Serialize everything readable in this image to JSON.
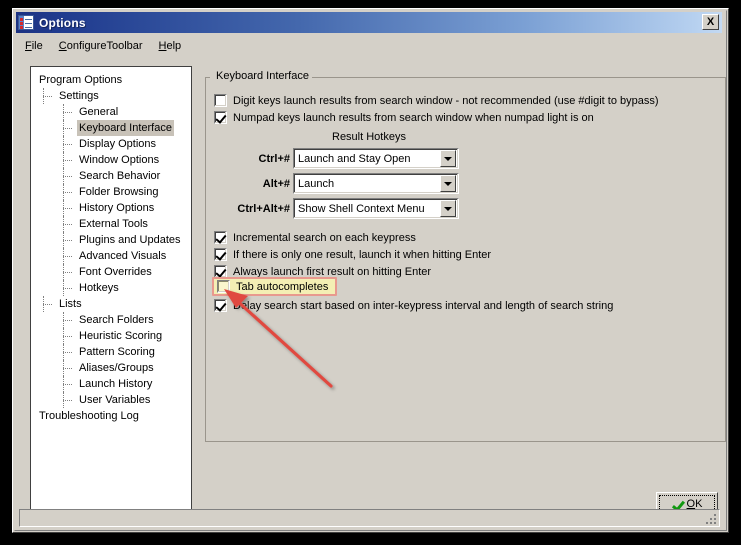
{
  "window": {
    "title": "Options",
    "icon": "options-checklist-icon",
    "close_label": "X",
    "titlebar_gradient_start": "#1c3282",
    "titlebar_gradient_end": "#c3d9f2",
    "face_color": "#d4d0c8"
  },
  "menubar": {
    "items": [
      {
        "label": "File",
        "accel": "F"
      },
      {
        "label": "ConfigureToolbar",
        "accel": "C"
      },
      {
        "label": "Help",
        "accel": "H"
      }
    ]
  },
  "tree": {
    "nodes": [
      {
        "label": "Program Options",
        "level": 0,
        "selected": false
      },
      {
        "label": "Settings",
        "level": 1,
        "selected": false
      },
      {
        "label": "General",
        "level": 2,
        "selected": false
      },
      {
        "label": "Keyboard Interface",
        "level": 2,
        "selected": true
      },
      {
        "label": "Display Options",
        "level": 2,
        "selected": false
      },
      {
        "label": "Window Options",
        "level": 2,
        "selected": false
      },
      {
        "label": "Search Behavior",
        "level": 2,
        "selected": false
      },
      {
        "label": "Folder Browsing",
        "level": 2,
        "selected": false
      },
      {
        "label": "History Options",
        "level": 2,
        "selected": false
      },
      {
        "label": "External Tools",
        "level": 2,
        "selected": false
      },
      {
        "label": "Plugins and Updates",
        "level": 2,
        "selected": false
      },
      {
        "label": "Advanced Visuals",
        "level": 2,
        "selected": false
      },
      {
        "label": "Font Overrides",
        "level": 2,
        "selected": false
      },
      {
        "label": "Hotkeys",
        "level": 2,
        "selected": false
      },
      {
        "label": "Lists",
        "level": 1,
        "selected": false
      },
      {
        "label": "Search Folders",
        "level": 2,
        "selected": false
      },
      {
        "label": "Heuristic Scoring",
        "level": 2,
        "selected": false
      },
      {
        "label": "Pattern Scoring",
        "level": 2,
        "selected": false
      },
      {
        "label": "Aliases/Groups",
        "level": 2,
        "selected": false
      },
      {
        "label": "Launch History",
        "level": 2,
        "selected": false
      },
      {
        "label": "User Variables",
        "level": 2,
        "selected": false
      },
      {
        "label": "Troubleshooting Log",
        "level": 0,
        "selected": false
      }
    ],
    "selected_highlight_color": "#c8c2b8"
  },
  "panel": {
    "group_title": "Keyboard Interface",
    "top_checkboxes": [
      {
        "label": "Digit keys launch results from search window  - not recommended (use #digit to bypass)",
        "checked": false
      },
      {
        "label": "Numpad keys launch results from search window when numpad light is on",
        "checked": true
      }
    ],
    "hotkeys": {
      "title": "Result Hotkeys",
      "rows": [
        {
          "label": "Ctrl+#",
          "value": "Launch and Stay Open"
        },
        {
          "label": "Alt+#",
          "value": "Launch"
        },
        {
          "label": "Ctrl+Alt+#",
          "value": "Show Shell Context Menu"
        }
      ]
    },
    "bottom_checkboxes": [
      {
        "label": "Incremental search on each keypress",
        "checked": true,
        "highlighted": false
      },
      {
        "label": "If there is only one result, launch it when hitting Enter",
        "checked": true,
        "highlighted": false
      },
      {
        "label": "Always launch first result on hitting Enter",
        "checked": true,
        "highlighted": false
      },
      {
        "label": "Tab autocompletes",
        "checked": false,
        "highlighted": true
      },
      {
        "label": "Delay search start based on inter-keypress interval and length of search string",
        "checked": true,
        "highlighted": false
      }
    ]
  },
  "footer": {
    "ok_label": "OK",
    "ok_accel": "O",
    "ok_icon": "green-check-icon"
  },
  "annotation": {
    "arrow_color": "#e04a40",
    "target": "tab-autocompletes-checkbox",
    "highlight_fill": "#f4efb4",
    "highlight_border": "#e8998e"
  }
}
